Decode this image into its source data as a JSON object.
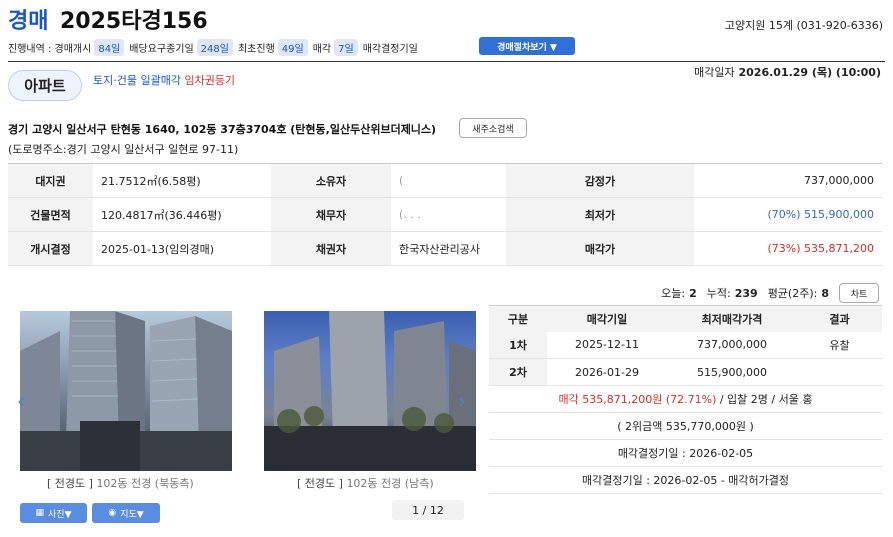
{
  "header": {
    "type_label": "경매",
    "case_number": "2025타경156",
    "court": "고양지원 15계 (031-920-6336)"
  },
  "progress": {
    "prefix": "진행내역 : 경매개시",
    "d1": "84일",
    "l2": "배당요구종기일",
    "d2": "248일",
    "l3": "최초진행",
    "d3": "49일",
    "l4": "매각",
    "d4": "7일",
    "l5": "매각결정기일",
    "doc_button": "경매절차보기 ▼"
  },
  "property": {
    "type": "아파트",
    "tag1": "토지·건물 일괄매각",
    "tag2": "임차권등기",
    "sale_date_label": "매각일자",
    "sale_date": "2026.01.29 (목) (10:00)",
    "address": "경기 고양시 일산서구 탄현동 1640, 102동 37층3704호 (탄현동,일산두산위브더제니스)",
    "addr_button": "새주소검색",
    "road_address": "(도로명주소:경기 고양시 일산서구 일현로 97-11)"
  },
  "info": {
    "r1": {
      "h1": "대지권",
      "v1": "21.7512㎡(6.58평)",
      "h2": "소유자",
      "v2": "(",
      "h3": "감정가",
      "v3": "737,000,000"
    },
    "r2": {
      "h1": "건물면적",
      "v1": "120.4817㎡(36.446평)",
      "h2": "채무자",
      "v2": "(. . .",
      "h3": "최저가",
      "v3": "(70%) 515,900,000"
    },
    "r3": {
      "h1": "개시결정",
      "v1": "2025-01-13(임의경매)",
      "h2": "채권자",
      "v2": "한국자산관리공사",
      "h3": "매각가",
      "v3": "(73%) 535,871,200"
    }
  },
  "views": {
    "today_label": "오늘:",
    "today": "2",
    "total_label": "누적:",
    "total": "239",
    "avg_label": "평균(2주):",
    "avg": "8",
    "chart_button": "차트"
  },
  "photos": {
    "cap1_bracket": "[ 전경도 ]",
    "cap1_sub": "102동 전경 (북동측)",
    "cap2_bracket": "[ 전경도 ]",
    "cap2_sub": "102동 전경 (남측)",
    "photo_btn": "사진▼",
    "map_btn": "지도▼",
    "pager": "1 / 12"
  },
  "history": {
    "headers": [
      "구분",
      "매각기일",
      "최저매각가격",
      "결과"
    ],
    "rows": [
      {
        "round": "1차",
        "date": "2025-12-11",
        "price": "737,000,000",
        "result": "유찰"
      },
      {
        "round": "2차",
        "date": "2026-01-29",
        "price": "515,900,000",
        "result": ""
      }
    ],
    "sold_red": "매각 535,871,200원 (72.71%)",
    "sold_rest": " / 입찰 2명 / 서울 홍",
    "second_bid": "( 2위금액 535,770,000원 )",
    "decision": "매각결정기일 : 2026-02-05",
    "decision2": "매각결정기일 : 2026-02-05 - 매각허가결정"
  },
  "colors": {
    "accent": "#1a56c4",
    "red": "#d92b2b",
    "button_blue": "#2f6fd6"
  }
}
